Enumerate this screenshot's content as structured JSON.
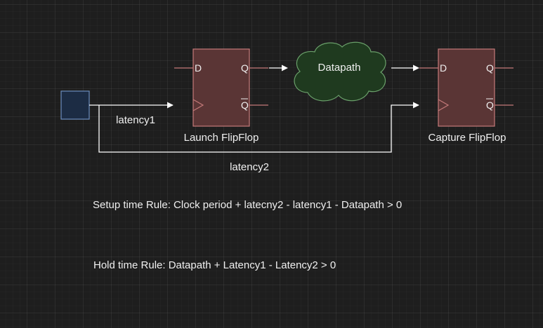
{
  "colors": {
    "background": "#1e1e1e",
    "flipflop_fill": "#5a3535",
    "flipflop_stroke": "#c47a7a",
    "pin_line": "#c47a7a",
    "cloud_fill": "#1f3a1f",
    "cloud_stroke": "#6aa06a",
    "clock_fill": "#1c2c44",
    "clock_stroke": "#6c8ebf",
    "wire": "#ffffff",
    "text": "#f0f0f0"
  },
  "launch_ff": {
    "label": "Launch FlipFlop",
    "pin_d": "D",
    "pin_q": "Q",
    "pin_qbar": "Q"
  },
  "capture_ff": {
    "label": "Capture FlipFlop",
    "pin_d": "D",
    "pin_q": "Q",
    "pin_qbar": "Q"
  },
  "datapath": {
    "label": "Datapath"
  },
  "clock_source": {
    "icon": "square-block-icon"
  },
  "wires": {
    "latency1": "latency1",
    "latency2": "latency2"
  },
  "rules": {
    "setup": "Setup time Rule: Clock period + latecny2 - latency1 - Datapath > 0",
    "hold": "Hold time Rule: Datapath + Latency1 - Latency2 > 0"
  }
}
